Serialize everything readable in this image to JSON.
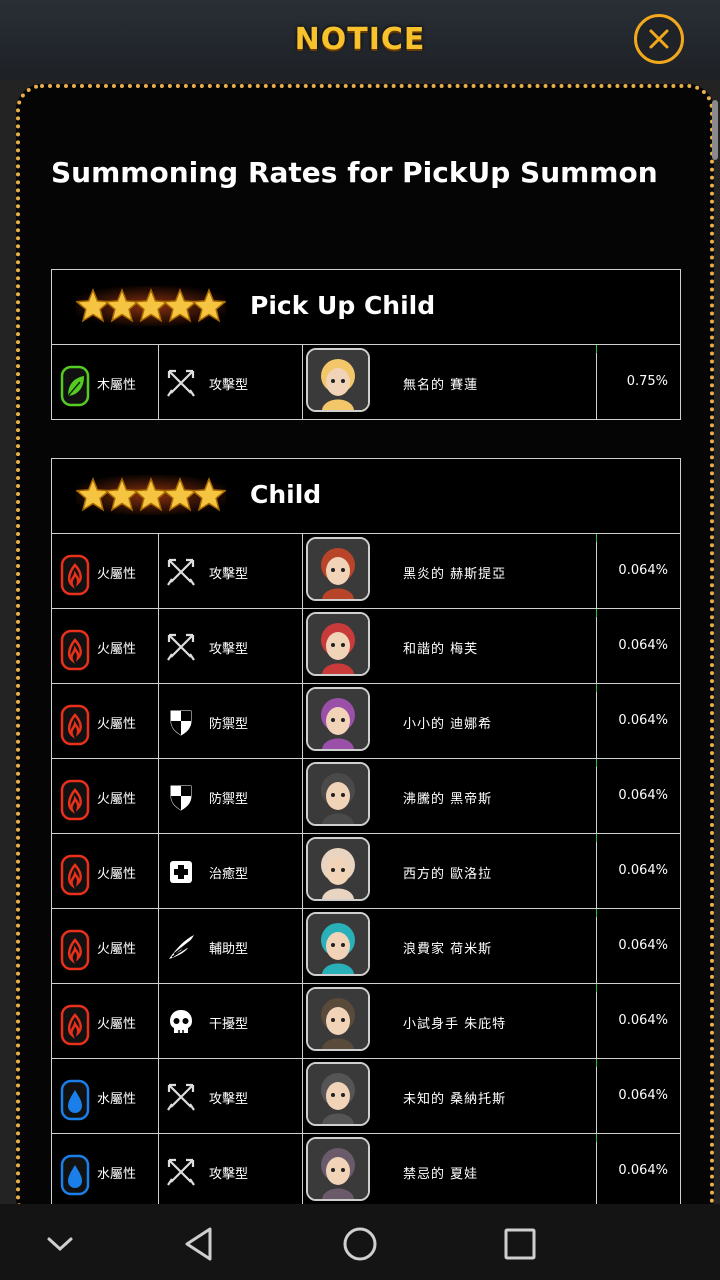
{
  "header": {
    "title": "NOTICE"
  },
  "heading": "Summoning Rates for PickUp Summon",
  "colors": {
    "fire": "#e8301a",
    "water": "#1a7fe8",
    "wood": "#55cc22",
    "gold": "#f2a81d"
  },
  "sections": [
    {
      "title": "Pick Up Child",
      "rows": [
        {
          "element": "木屬性",
          "element_icon": "wood-leaf-icon",
          "type": "攻擊型",
          "type_icon": "swords-icon",
          "name": "無名的 賽蓮",
          "rate": "0.75%"
        }
      ]
    },
    {
      "title": "Child",
      "rows": [
        {
          "element": "火屬性",
          "element_icon": "fire-flame-icon",
          "type": "攻擊型",
          "type_icon": "swords-icon",
          "name": "黑炎的 赫斯提亞",
          "rate": "0.064%"
        },
        {
          "element": "火屬性",
          "element_icon": "fire-flame-icon",
          "type": "攻擊型",
          "type_icon": "swords-icon",
          "name": "和諧的 梅芙",
          "rate": "0.064%"
        },
        {
          "element": "火屬性",
          "element_icon": "fire-flame-icon",
          "type": "防禦型",
          "type_icon": "shield-icon",
          "name": "小小的 迪娜希",
          "rate": "0.064%"
        },
        {
          "element": "火屬性",
          "element_icon": "fire-flame-icon",
          "type": "防禦型",
          "type_icon": "shield-icon",
          "name": "沸騰的 黑帝斯",
          "rate": "0.064%"
        },
        {
          "element": "火屬性",
          "element_icon": "fire-flame-icon",
          "type": "治癒型",
          "type_icon": "medical-cross-icon",
          "name": "西方的 歐洛拉",
          "rate": "0.064%"
        },
        {
          "element": "火屬性",
          "element_icon": "fire-flame-icon",
          "type": "輔助型",
          "type_icon": "wing-icon",
          "name": "浪費家 荷米斯",
          "rate": "0.064%"
        },
        {
          "element": "火屬性",
          "element_icon": "fire-flame-icon",
          "type": "干擾型",
          "type_icon": "skull-icon",
          "name": "小試身手 朱庇特",
          "rate": "0.064%"
        },
        {
          "element": "水屬性",
          "element_icon": "water-drop-icon",
          "type": "攻擊型",
          "type_icon": "swords-icon",
          "name": "未知的 桑納托斯",
          "rate": "0.064%"
        },
        {
          "element": "水屬性",
          "element_icon": "water-drop-icon",
          "type": "攻擊型",
          "type_icon": "swords-icon",
          "name": "禁忌的 夏娃",
          "rate": "0.064%"
        }
      ]
    }
  ],
  "navbar": [
    "back-chevron-icon",
    "back-triangle-icon",
    "home-circle-icon",
    "recents-square-icon"
  ]
}
